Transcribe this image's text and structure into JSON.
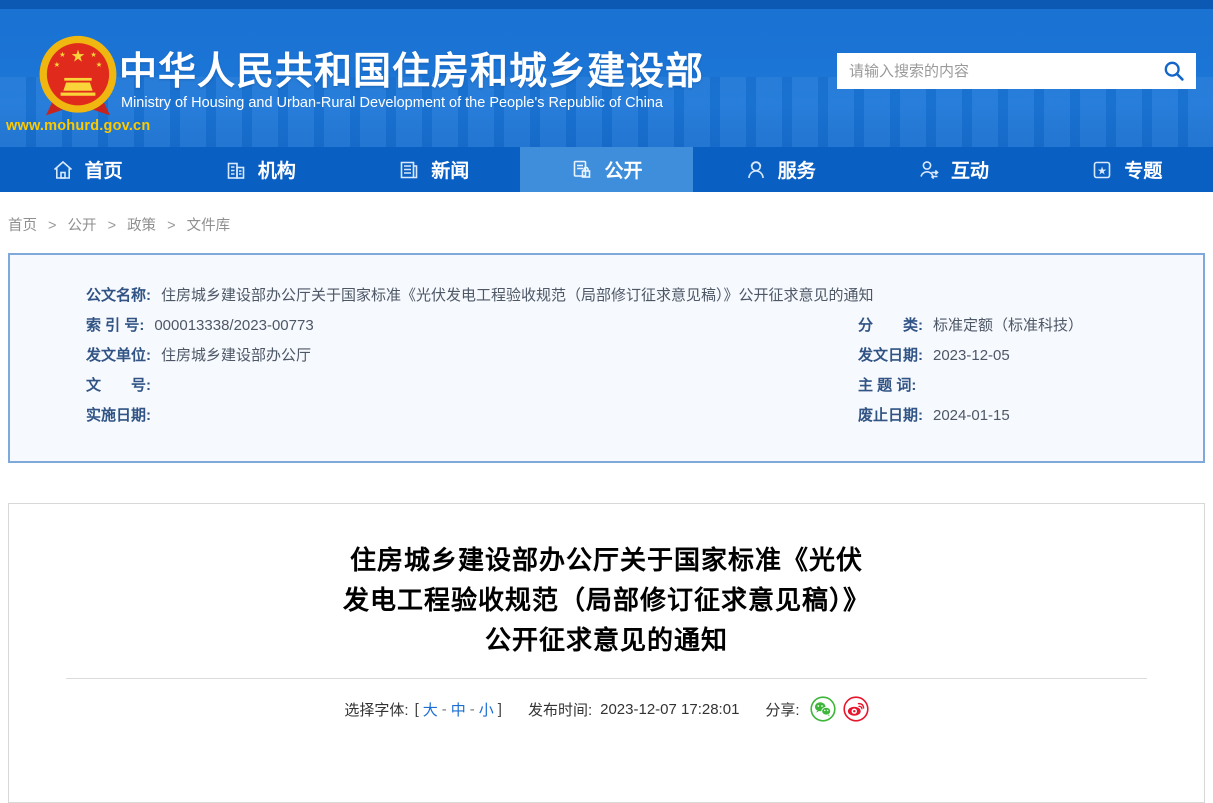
{
  "header": {
    "site_title": "中华人民共和国住房和城乡建设部",
    "site_subtitle": "Ministry of Housing and Urban-Rural Development of the People's Republic of China",
    "site_url": "www.mohurd.gov.cn",
    "search_placeholder": "请输入搜索的内容"
  },
  "nav": {
    "items": [
      {
        "label": "首页"
      },
      {
        "label": "机构"
      },
      {
        "label": "新闻"
      },
      {
        "label": "公开",
        "active": true
      },
      {
        "label": "服务"
      },
      {
        "label": "互动"
      },
      {
        "label": "专题"
      }
    ]
  },
  "breadcrumb": {
    "separator": ">",
    "items": [
      "首页",
      "公开",
      "政策",
      "文件库"
    ]
  },
  "doc_meta": {
    "name_label": "公文名称:",
    "name_value": "住房城乡建设部办公厅关于国家标准《光伏发电工程验收规范（局部修订征求意见稿）》公开征求意见的通知",
    "fields_left": [
      {
        "label": "索 引 号:",
        "value": "000013338/2023-00773"
      },
      {
        "label": "发文单位:",
        "value": "住房城乡建设部办公厅"
      },
      {
        "label": "文　　号:",
        "value": ""
      },
      {
        "label": "实施日期:",
        "value": ""
      }
    ],
    "fields_right": [
      {
        "label": "分　　类:",
        "value": "标准定额（标准科技）"
      },
      {
        "label": "发文日期:",
        "value": "2023-12-05"
      },
      {
        "label": "主 题 词:",
        "value": ""
      },
      {
        "label": "废止日期:",
        "value": "2024-01-15"
      }
    ]
  },
  "article": {
    "title_lines": [
      "住房城乡建设部办公厅关于国家标准《光伏",
      "发电工程验收规范（局部修订征求意见稿）》",
      "公开征求意见的通知"
    ],
    "font_selector": {
      "label": "选择字体:",
      "open_bracket": "[",
      "size_large": "大",
      "size_medium": "中",
      "size_small": "小",
      "dash": "-",
      "close_bracket": "]"
    },
    "publish_label": "发布时间:",
    "publish_time": "2023-12-07 17:28:01",
    "share_label": "分享:"
  },
  "colors": {
    "header_blue": "#1a72d2",
    "nav_blue": "#0a5fc3",
    "nav_active_blue": "#3e8edb",
    "gold": "#fcca00",
    "meta_box_bg": "#f6f9fd",
    "meta_box_border": "#7ea9da",
    "meta_label": "#315485",
    "link_blue": "#1b6ed2",
    "wechat_green": "#3db639",
    "weibo_red": "#e6162d"
  }
}
